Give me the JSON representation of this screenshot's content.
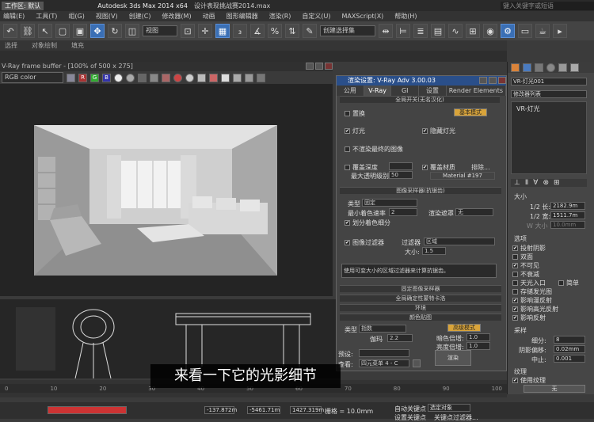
{
  "titlebar": {
    "workspace_label": "工作区: 默认",
    "app_title": "Autodesk 3ds Max  2014 x64",
    "file_title": "设计表现挑战赛2014.max",
    "search_placeholder": "键入关键字或短语"
  },
  "menubar": {
    "items": [
      "编辑(E)",
      "工具(T)",
      "组(G)",
      "视图(V)",
      "创建(C)",
      "修改器(M)",
      "动画",
      "图形编辑器",
      "渲染(R)",
      "自定义(U)",
      "MAXScript(X)",
      "帮助(H)"
    ]
  },
  "toolbar": {
    "view_dropdown": "视图",
    "selection_set": "创建选择集"
  },
  "subbar": {
    "labels": [
      "选择",
      "对象绘制",
      "填充"
    ]
  },
  "framebuffer": {
    "title": "V-Ray frame buffer - [100% of 500 x 275]",
    "channel": "RGB color",
    "swatches": [
      "R",
      "G",
      "B"
    ]
  },
  "vray_dialog": {
    "title": "渲染设置: V-Ray Adv 3.00.03",
    "tabs": [
      "公用",
      "V-Ray",
      "GI",
      "设置",
      "Render Elements"
    ],
    "global_switches": {
      "section": "全局开关(无名汉化)",
      "override": "置换",
      "basic_mode": "基本模式",
      "lights": "灯光",
      "hidden_lights": "隐藏灯光",
      "no_render_final": "不渲染最终的图像",
      "override_depth": "覆盖深度",
      "max_transp": "最大透明级别",
      "max_transp_val": "50",
      "override_mtl": "覆盖材质",
      "exclude": "排除...",
      "material": "Material #197"
    },
    "image_sampler": {
      "section": "图像采样器(抗锯齿)",
      "type_label": "类型",
      "type_val": "固定",
      "min_shading": "最小着色速率",
      "min_shading_val": "2",
      "render_mask": "渲染遮罩",
      "render_mask_val": "无",
      "divide": "划分着色细分",
      "filter_label": "图像过滤器",
      "filter": "过滤器",
      "filter_val": "区域",
      "size_label": "大小:",
      "size_val": "1.5",
      "desc": "使用可变大小的区域过滤器来计算抗锯齿。"
    },
    "sections": [
      "固定图像采样器",
      "全局确定性蒙特卡洛",
      "环境",
      "颜色贴图"
    ],
    "color_map": {
      "type_label": "类型",
      "type_val": "指数",
      "expert": "高级模式",
      "gamma_label": "伽玛",
      "gamma_val": "2.2",
      "dark_label": "暗色倍增:",
      "dark_val": "1.0",
      "bright_label": "亮度倍增:",
      "bright_val": "1.0"
    },
    "preset_label": "预设:",
    "view_label": "查看:",
    "view_val": "四元菜单 4 - C",
    "render_btn": "渲染"
  },
  "rpanel": {
    "object_name": "VR-灯光001",
    "modifier_list": "修改器列表",
    "stack_item": "VR-灯光",
    "size_section": "大小",
    "half_len": "1/2 长:",
    "half_len_val": "2182.9m",
    "half_wid": "1/2 宽:",
    "half_wid_val": "1511.7m",
    "w_size": "W 大小",
    "w_size_val": "10.0mm",
    "options_section": "选项",
    "options": [
      {
        "label": "投射阴影",
        "on": true
      },
      {
        "label": "双面",
        "on": false
      },
      {
        "label": "不可见",
        "on": true
      },
      {
        "label": "不衰减",
        "on": false
      },
      {
        "label": "天光入口",
        "on": false
      },
      {
        "label": "存储发光图",
        "on": false
      },
      {
        "label": "影响漫反射",
        "on": true
      },
      {
        "label": "影响高光反射",
        "on": true
      },
      {
        "label": "影响反射",
        "on": true
      }
    ],
    "simple": "简单",
    "sampling_section": "采样",
    "subdiv": "细分:",
    "subdiv_val": "8",
    "shadow_bias": "阴影偏移:",
    "shadow_bias_val": "0.02mm",
    "cutoff": "中止:",
    "cutoff_val": "0.001",
    "texture_section": "纹理",
    "use_texture": "使用纹理",
    "none_label": "无"
  },
  "timeline": {
    "ticks": [
      "0",
      "10",
      "20",
      "30",
      "40",
      "50",
      "60",
      "70",
      "80",
      "90",
      "100"
    ]
  },
  "statusbar": {
    "x_val": "-137.872m",
    "y_val": "-5461.71m",
    "z_val": "1427.319m",
    "grid": "栅格 = 10.0mm",
    "autokey": "自动关键点",
    "selected": "选定对象",
    "set_key": "设置关键点",
    "key_filter": "关键点过滤器..."
  },
  "subtitle": "来看一下它的光影细节"
}
